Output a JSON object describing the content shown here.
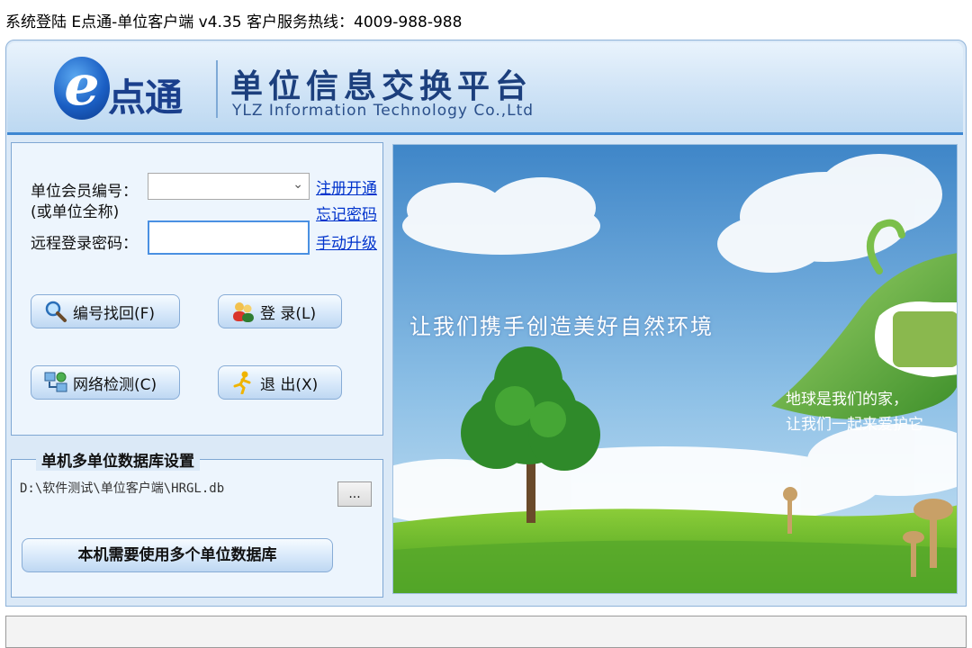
{
  "window": {
    "title": "系统登陆  E点通-单位客户端  v4.35  客户服务热线：4009-988-988"
  },
  "header": {
    "logo_e": "e",
    "logo_text": "点通",
    "platform_title": "单位信息交换平台",
    "platform_subtitle": "YLZ Information Technology Co.,Ltd"
  },
  "login": {
    "member_label_line1": "单位会员编号：",
    "member_label_line2": "(或单位全称)",
    "password_label": "远程登录密码：",
    "member_value": "",
    "password_value": "",
    "links": {
      "register": "注册开通",
      "forgot": "忘记密码",
      "upgrade": "手动升级"
    },
    "buttons": {
      "retrieve": "编号找回(F)",
      "login": "登 录(L)",
      "network": "网络检测(C)",
      "exit": "退 出(X)"
    }
  },
  "database": {
    "legend": "单机多单位数据库设置",
    "path": "D:\\软件测试\\单位客户端\\HRGL.db",
    "browse_label": "...",
    "multi_button": "本机需要使用多个单位数据库"
  },
  "banner": {
    "slogan": "让我们携手创造美好自然环境",
    "leaf_line1": "地球是我们的家，",
    "leaf_line2": "让我们一起来爱护它"
  },
  "status": {
    "text": ""
  },
  "colors": {
    "frame_bg": "#dbe9f7",
    "accent_blue": "#3d86d1",
    "link_blue": "#0033cc",
    "title_navy": "#1c3f7d"
  }
}
